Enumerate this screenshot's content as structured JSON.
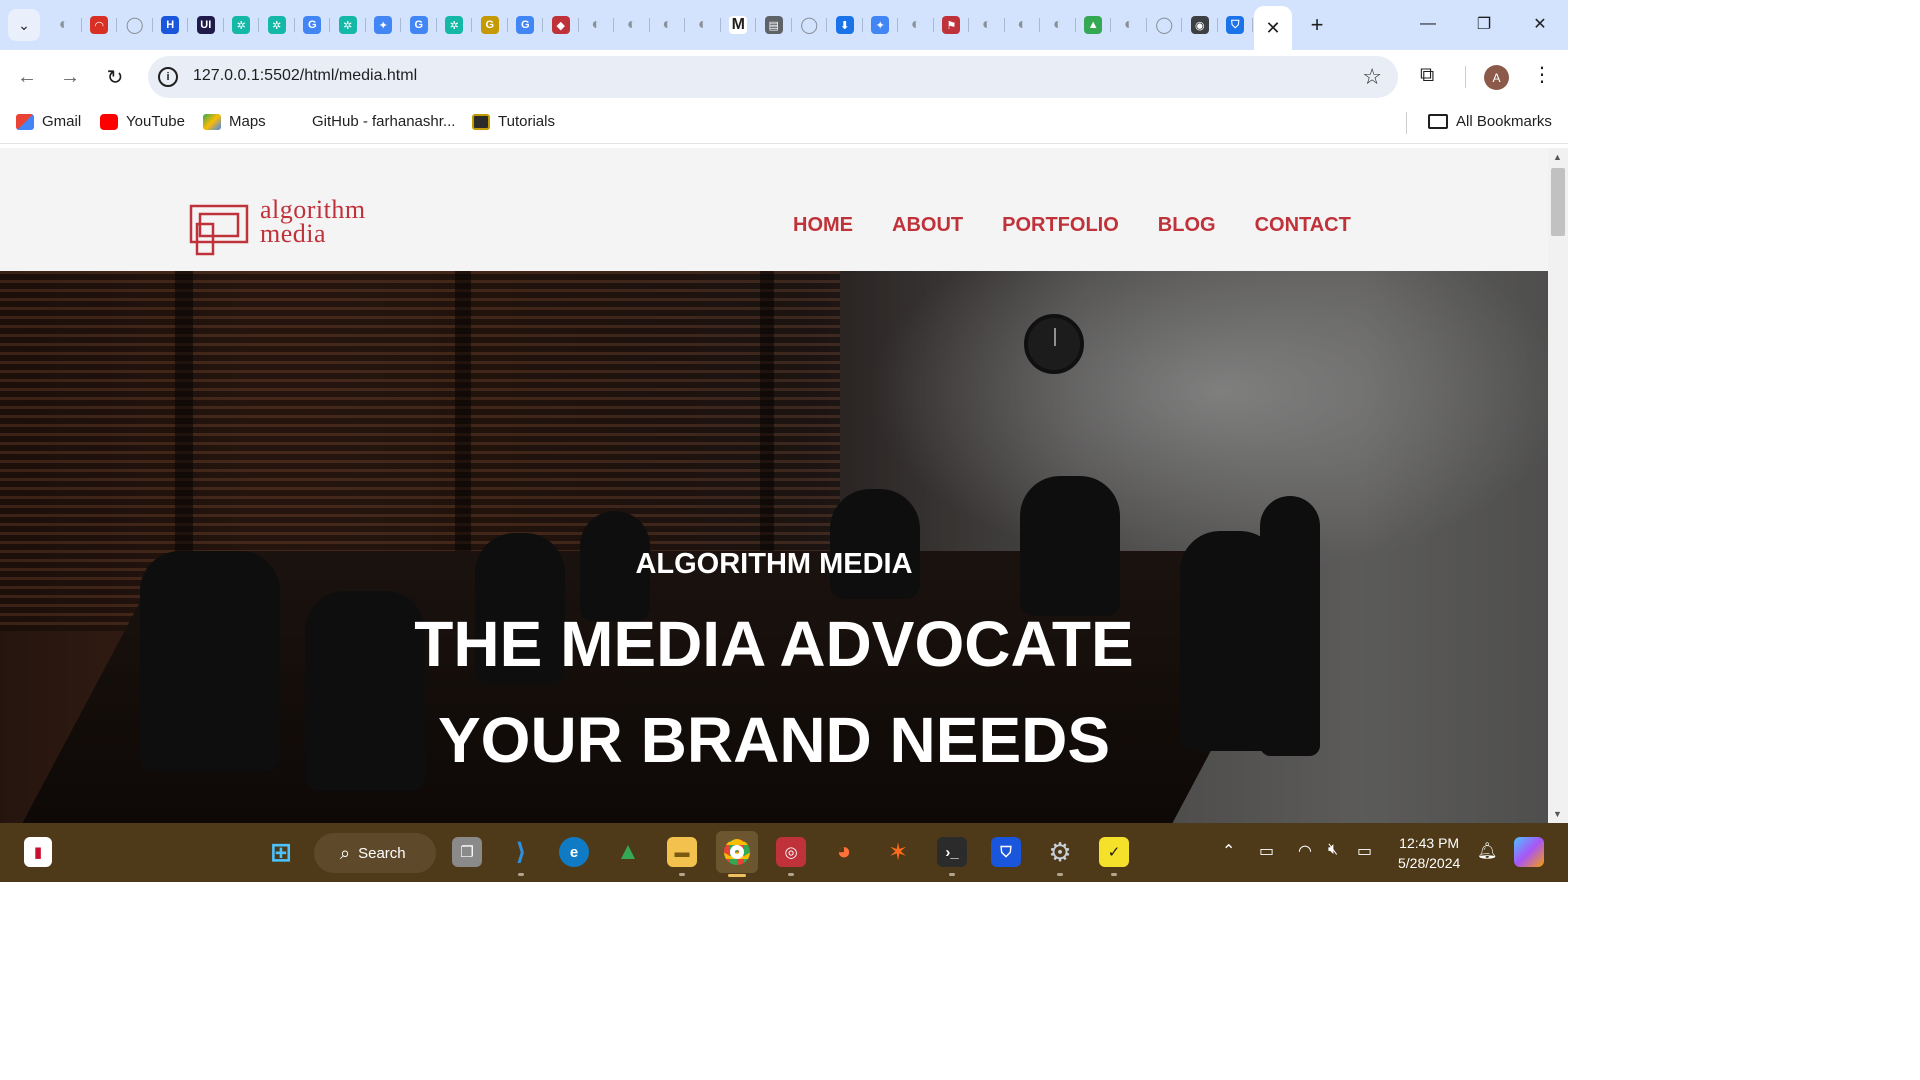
{
  "browser": {
    "tab_search_icon": "chevron-down-icon",
    "tab_favicons": [
      {
        "name": "globe-icon",
        "color": "#9aa0a6",
        "glyph": "◐"
      },
      {
        "name": "speedometer-icon",
        "color": "#d93025",
        "glyph": "◠"
      },
      {
        "name": "github-icon",
        "color": "#9aa0a6",
        "glyph": "◯"
      },
      {
        "name": "h-icon",
        "color": "#1a56db",
        "glyph": "H"
      },
      {
        "name": "ui-icon",
        "color": "#1e1b4b",
        "glyph": "UI"
      },
      {
        "name": "butterfly-icon",
        "color": "#14b8a6",
        "glyph": "✲"
      },
      {
        "name": "butterfly-icon",
        "color": "#14b8a6",
        "glyph": "✲"
      },
      {
        "name": "google-icon",
        "color": "#4285f4",
        "glyph": "G"
      },
      {
        "name": "butterfly-icon",
        "color": "#14b8a6",
        "glyph": "✲"
      },
      {
        "name": "sparkle-icon",
        "color": "#4285f4",
        "glyph": "✦"
      },
      {
        "name": "google-icon",
        "color": "#4285f4",
        "glyph": "G"
      },
      {
        "name": "butterfly-icon",
        "color": "#14b8a6",
        "glyph": "✲"
      },
      {
        "name": "g-icon",
        "color": "#c49a00",
        "glyph": "G"
      },
      {
        "name": "google-icon",
        "color": "#4285f4",
        "glyph": "G"
      },
      {
        "name": "gamepad-icon",
        "color": "#c0323a",
        "glyph": "◆"
      },
      {
        "name": "globe-icon",
        "color": "#9aa0a6",
        "glyph": "◐"
      },
      {
        "name": "globe-icon",
        "color": "#9aa0a6",
        "glyph": "◐"
      },
      {
        "name": "globe-icon",
        "color": "#9aa0a6",
        "glyph": "◐"
      },
      {
        "name": "globe-icon",
        "color": "#9aa0a6",
        "glyph": "◐"
      },
      {
        "name": "m-icon",
        "color": "#ffffff",
        "glyph": "M"
      },
      {
        "name": "document-icon",
        "color": "#5f6368",
        "glyph": "▤"
      },
      {
        "name": "github-icon",
        "color": "#9aa0a6",
        "glyph": "◯"
      },
      {
        "name": "download-icon",
        "color": "#1a73e8",
        "glyph": "⬇"
      },
      {
        "name": "sparkle-icon",
        "color": "#4285f4",
        "glyph": "✦"
      },
      {
        "name": "globe-icon",
        "color": "#9aa0a6",
        "glyph": "◐"
      },
      {
        "name": "flag-icon",
        "color": "#c0323a",
        "glyph": "⚑"
      },
      {
        "name": "globe-icon",
        "color": "#9aa0a6",
        "glyph": "◐"
      },
      {
        "name": "globe-icon",
        "color": "#9aa0a6",
        "glyph": "◐"
      },
      {
        "name": "globe-icon",
        "color": "#9aa0a6",
        "glyph": "◐"
      },
      {
        "name": "drive-icon",
        "color": "#34a853",
        "glyph": "▲"
      },
      {
        "name": "globe-icon",
        "color": "#9aa0a6",
        "glyph": "◐"
      },
      {
        "name": "github-icon",
        "color": "#9aa0a6",
        "glyph": "◯"
      },
      {
        "name": "chrome-icon",
        "color": "#3c4043",
        "glyph": "◉"
      },
      {
        "name": "shield-icon",
        "color": "#1a73e8",
        "glyph": "⛉"
      }
    ],
    "active_tab_close": "✕",
    "new_tab": "+",
    "minimize": "—",
    "restore": "❐",
    "close": "✕",
    "back": "←",
    "forward": "→",
    "reload": "↻",
    "site_info": "i",
    "url": "127.0.0.1:5502/html/media.html",
    "bookmark_star": "☆",
    "extensions": "⧉",
    "profile_initial": "A",
    "menu": "⋮"
  },
  "bookmarks_bar": {
    "items": [
      {
        "label": "Gmail",
        "icon": "gmail-icon",
        "color": "#ea4335"
      },
      {
        "label": "YouTube",
        "icon": "youtube-icon",
        "color": "#ff0000"
      },
      {
        "label": "Maps",
        "icon": "maps-icon",
        "color": "#34a853"
      },
      {
        "label": "GitHub - farhanashr...",
        "icon": "",
        "color": ""
      },
      {
        "label": "Tutorials",
        "icon": "g-icon",
        "color": "#c49a00"
      }
    ],
    "all_bookmarks": "All Bookmarks"
  },
  "site": {
    "logo_line1": "algorithm",
    "logo_line2": "media",
    "brand_color": "#c0323a",
    "nav": [
      "HOME",
      "ABOUT",
      "PORTFOLIO",
      "BLOG",
      "CONTACT"
    ],
    "hero_subtitle": "ALGORITHM MEDIA",
    "hero_title_line1": "THE MEDIA ADVOCATE",
    "hero_title_line2": "YOUR BRAND NEEDS"
  },
  "taskbar": {
    "search_label": "Search",
    "time": "12:43 PM",
    "date": "5/28/2024"
  }
}
